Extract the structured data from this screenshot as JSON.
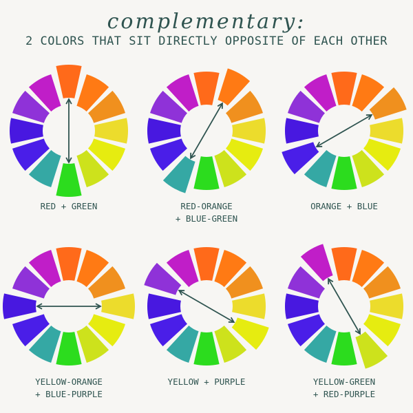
{
  "header": {
    "title": "complementary:",
    "subtitle": "2 COLORS THAT SIT DIRECTLY OPPOSITE OF EACH OTHER"
  },
  "segment_colors": [
    "#ff6a1a",
    "#ff7a14",
    "#f0901e",
    "#ecdc2c",
    "#e6ec10",
    "#cde21c",
    "#2cdc1e",
    "#35a8a4",
    "#4a1ee8",
    "#4818e0",
    "#8f32d8",
    "#c01ec8"
  ],
  "arrow_color": "#2f5450",
  "wheels": [
    {
      "caption_line1": "RED + GREEN",
      "caption_line2": "",
      "pair": [
        0,
        6
      ]
    },
    {
      "caption_line1": "RED-ORANGE",
      "caption_line2": "+ BLUE-GREEN",
      "pair": [
        1,
        7
      ]
    },
    {
      "caption_line1": "ORANGE + BLUE",
      "caption_line2": "",
      "pair": [
        2,
        8
      ]
    },
    {
      "caption_line1": "YELLOW-ORANGE",
      "caption_line2": "+ BLUE-PURPLE",
      "pair": [
        3,
        9
      ]
    },
    {
      "caption_line1": "YELLOW + PURPLE",
      "caption_line2": "",
      "pair": [
        4,
        10
      ]
    },
    {
      "caption_line1": "YELLOW-GREEN",
      "caption_line2": "+ RED-PURPLE",
      "pair": [
        5,
        11
      ]
    }
  ]
}
